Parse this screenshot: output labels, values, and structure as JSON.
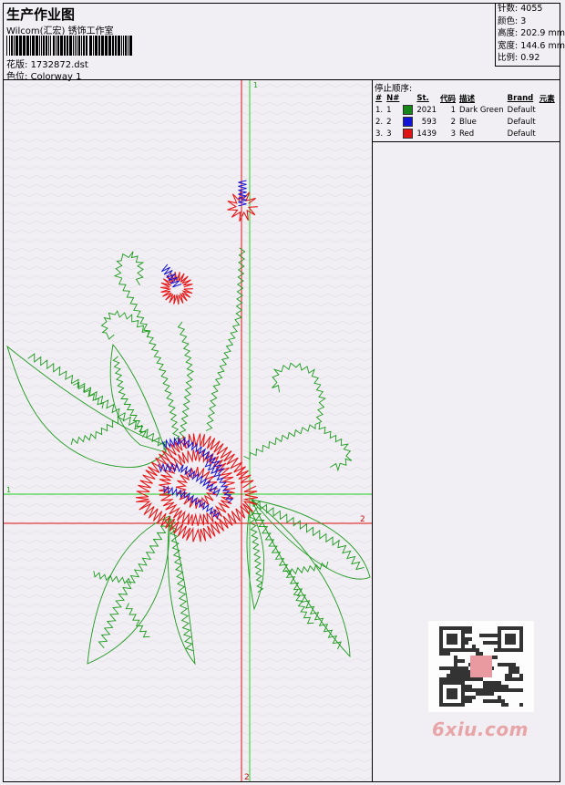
{
  "header": {
    "title": "生产作业图",
    "company": "Wilcom(汇宏) 锈饰工作室",
    "file_label": "花版:",
    "file_value": "1732872.dst",
    "colorway_label": "色位:",
    "colorway_value": "Colorway 1"
  },
  "stats": {
    "stitches_label": "针数:",
    "stitches_value": "4055",
    "colors_label": "颜色:",
    "colors_value": "3",
    "height_label": "高度:",
    "height_value": "202.9 mm",
    "width_label": "宽度:",
    "width_value": "144.6 mm",
    "scale_label": "比例:",
    "scale_value": "0.92"
  },
  "stop_sequence": {
    "title": "停止顺序:",
    "columns": [
      "#",
      "N#",
      "St.",
      "代码",
      "描述",
      "Brand",
      "元素"
    ],
    "rows": [
      {
        "index": "1.",
        "n": "1",
        "color": "#16861a",
        "stitches": "2021",
        "code": "1",
        "description": "Dark Green",
        "brand": "Default"
      },
      {
        "index": "2.",
        "n": "2",
        "color": "#1212d8",
        "stitches": "593",
        "code": "2",
        "description": "Blue",
        "brand": "Default"
      },
      {
        "index": "3.",
        "n": "3",
        "color": "#e01414",
        "stitches": "1439",
        "code": "3",
        "description": "Red",
        "brand": "Default"
      }
    ]
  },
  "markers": {
    "green_top": "1",
    "green_left": "1",
    "red_right": "2",
    "red_bottom": "2"
  },
  "watermark": "6xiu.com",
  "colors": {
    "green": "#1c9a1c",
    "blue": "#1414d6",
    "red": "#e81818",
    "guide_green": "#20d020",
    "guide_red": "#e01010"
  }
}
